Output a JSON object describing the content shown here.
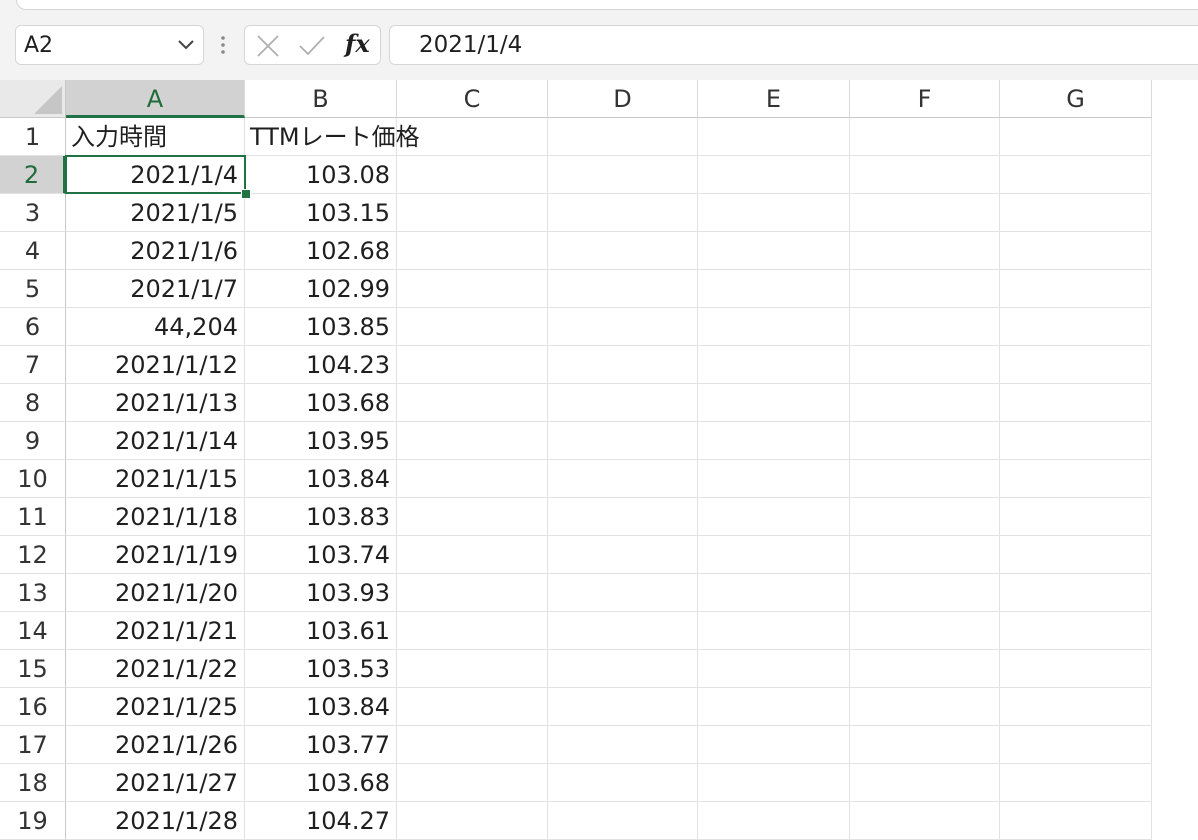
{
  "formula_bar": {
    "name_box": "A2",
    "fx_label": "fx",
    "formula": "2021/1/4"
  },
  "columns": [
    "A",
    "B",
    "C",
    "D",
    "E",
    "F",
    "G"
  ],
  "active_cell": "A2",
  "rows": [
    {
      "num": "1",
      "a": "入力時間",
      "b": "TTMレート価格"
    },
    {
      "num": "2",
      "a": "2021/1/4",
      "b": "103.08"
    },
    {
      "num": "3",
      "a": "2021/1/5",
      "b": "103.15"
    },
    {
      "num": "4",
      "a": "2021/1/6",
      "b": "102.68"
    },
    {
      "num": "5",
      "a": "2021/1/7",
      "b": "102.99"
    },
    {
      "num": "6",
      "a": "44,204",
      "b": "103.85"
    },
    {
      "num": "7",
      "a": "2021/1/12",
      "b": "104.23"
    },
    {
      "num": "8",
      "a": "2021/1/13",
      "b": "103.68"
    },
    {
      "num": "9",
      "a": "2021/1/14",
      "b": "103.95"
    },
    {
      "num": "10",
      "a": "2021/1/15",
      "b": "103.84"
    },
    {
      "num": "11",
      "a": "2021/1/18",
      "b": "103.83"
    },
    {
      "num": "12",
      "a": "2021/1/19",
      "b": "103.74"
    },
    {
      "num": "13",
      "a": "2021/1/20",
      "b": "103.93"
    },
    {
      "num": "14",
      "a": "2021/1/21",
      "b": "103.61"
    },
    {
      "num": "15",
      "a": "2021/1/22",
      "b": "103.53"
    },
    {
      "num": "16",
      "a": "2021/1/25",
      "b": "103.84"
    },
    {
      "num": "17",
      "a": "2021/1/26",
      "b": "103.77"
    },
    {
      "num": "18",
      "a": "2021/1/27",
      "b": "103.68"
    },
    {
      "num": "19",
      "a": "2021/1/28",
      "b": "104.27"
    }
  ],
  "colors": {
    "accent": "#217346",
    "header_active_bg": "#d2d2d2",
    "gridline": "#e2e2e2"
  }
}
